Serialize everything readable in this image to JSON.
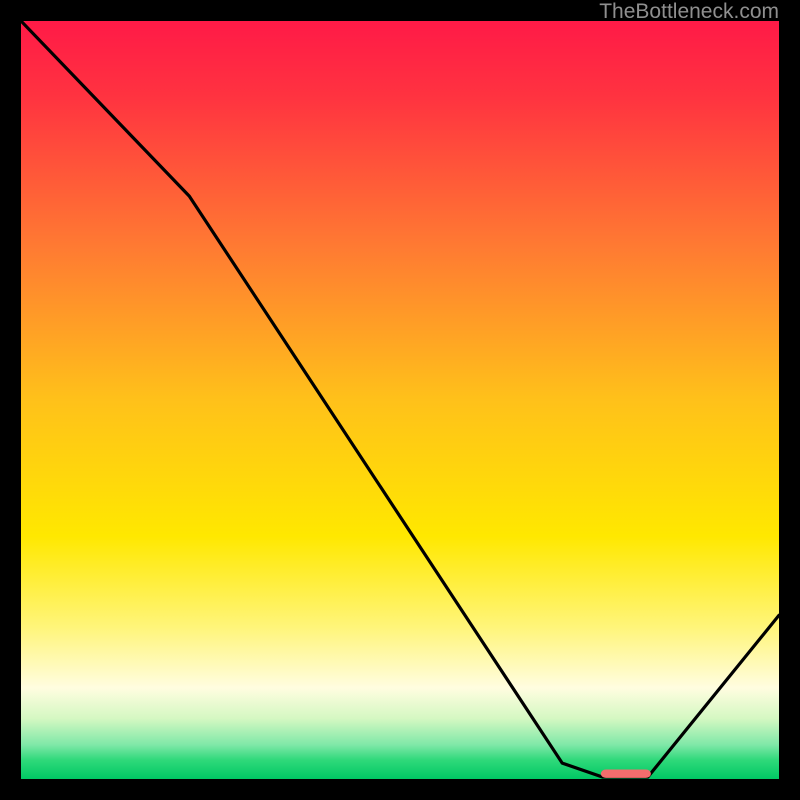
{
  "watermark": {
    "text": "TheBottleneck.com"
  },
  "chart_data": {
    "type": "line",
    "title": "",
    "xlabel": "",
    "ylabel": "",
    "xlim": [
      0,
      100
    ],
    "ylim": [
      0,
      100
    ],
    "grid": false,
    "gradient_stops": [
      {
        "offset": 0,
        "color": "#ff1a47"
      },
      {
        "offset": 0.1,
        "color": "#ff3340"
      },
      {
        "offset": 0.3,
        "color": "#ff7b32"
      },
      {
        "offset": 0.5,
        "color": "#ffc11a"
      },
      {
        "offset": 0.68,
        "color": "#ffe800"
      },
      {
        "offset": 0.8,
        "color": "#fff57a"
      },
      {
        "offset": 0.88,
        "color": "#fffde0"
      },
      {
        "offset": 0.92,
        "color": "#d5f8c2"
      },
      {
        "offset": 0.955,
        "color": "#7fe8a8"
      },
      {
        "offset": 0.975,
        "color": "#2fd97a"
      },
      {
        "offset": 1.0,
        "color": "#00c864"
      }
    ],
    "series": [
      {
        "name": "bottleneck-curve",
        "type": "line",
        "x": [
          0.0,
          22.2,
          71.4,
          76.7,
          82.7,
          100.0
        ],
        "y": [
          100.0,
          76.9,
          2.1,
          0.26,
          0.26,
          21.6
        ]
      },
      {
        "name": "optimal-marker",
        "type": "marker",
        "x": 79.8,
        "y": 0.7,
        "width_pct": 6.6,
        "height_pct": 1.1,
        "color": "#f26d6d",
        "shape": "rounded-rect"
      }
    ]
  }
}
